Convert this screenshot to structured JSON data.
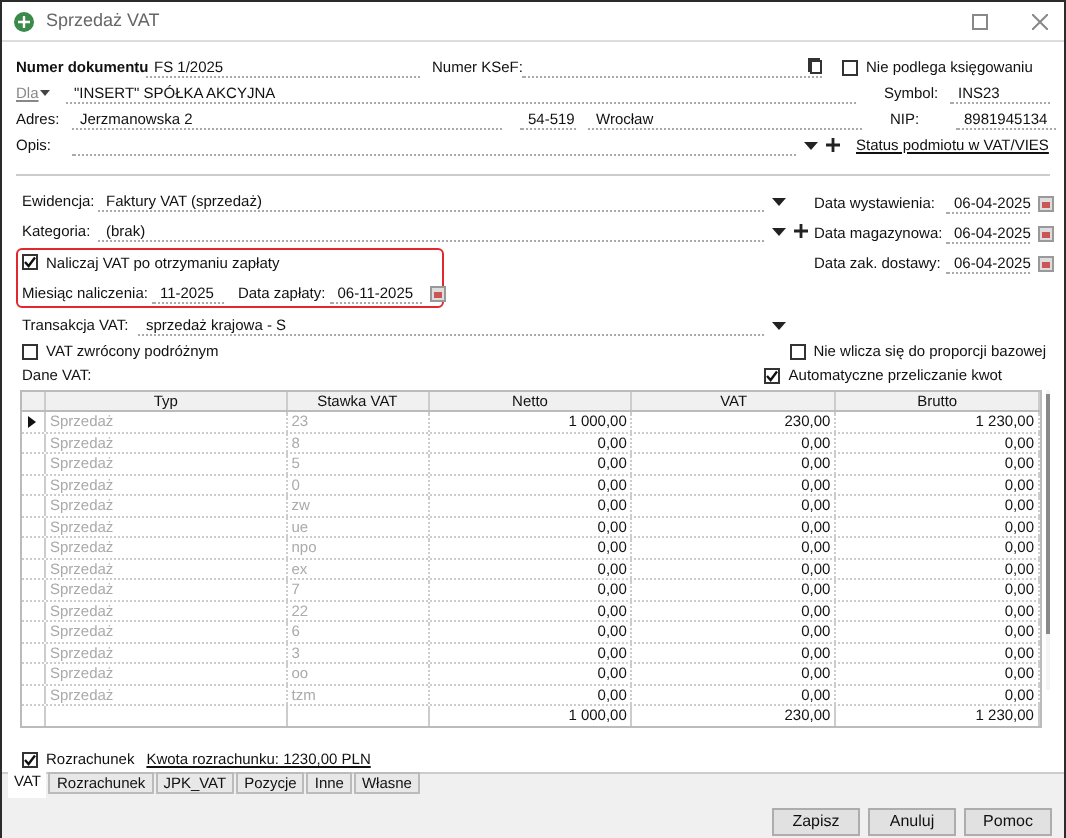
{
  "window": {
    "title": "Sprzedaż VAT"
  },
  "document": {
    "number_label": "Numer dokumentu",
    "number": "FS 1/2025",
    "ksef_label": "Numer KSeF:",
    "not_booked": {
      "label": "Nie podlega księgowaniu",
      "checked": false
    }
  },
  "counterparty": {
    "for_label": "Dla",
    "name": "\"INSERT\" SPÓŁKA AKCYJNA",
    "symbol_label": "Symbol:",
    "symbol": "INS23",
    "address_label": "Adres:",
    "street": "Jerzmanowska 2",
    "postcode": "54-519",
    "city": "Wrocław",
    "nip_label": "NIP:",
    "nip": "8981945134",
    "description_label": "Opis:",
    "vies_link": "Status podmiotu w VAT/VIES"
  },
  "register": {
    "label": "Ewidencja:",
    "value": "Faktury VAT (sprzedaż)"
  },
  "category": {
    "label": "Kategoria:",
    "value": "(brak)"
  },
  "dates": [
    {
      "label": "Data wystawienia:",
      "value": "06-04-2025"
    },
    {
      "label": "Data magazynowa:",
      "value": "06-04-2025"
    },
    {
      "label": "Data zak. dostawy:",
      "value": "06-04-2025"
    }
  ],
  "cash_vat": {
    "label": "Naliczaj VAT po otrzymaniu zapłaty",
    "checked": true,
    "month_label": "Miesiąc naliczenia:",
    "month": "11-2025",
    "payment_date_label": "Data zapłaty:",
    "payment_date": "06-11-2025"
  },
  "transaction": {
    "label": "Transakcja VAT:",
    "value": "sprzedaż krajowa - S"
  },
  "options": [
    {
      "label": "VAT zwrócony podróżnym",
      "checked": false
    },
    {
      "label": "Nie wlicza się do proporcji bazowej",
      "checked": false
    },
    {
      "label": "Automatyczne przeliczanie kwot",
      "checked": true
    }
  ],
  "table": {
    "label": "Dane VAT:",
    "columns": [
      "Typ",
      "Stawka VAT",
      "Netto",
      "VAT",
      "Brutto"
    ],
    "rows": [
      {
        "cells": [
          "Sprzedaż",
          "23",
          "1 000,00",
          "230,00",
          "1 230,00"
        ],
        "selected": true
      },
      {
        "cells": [
          "Sprzedaż",
          "8",
          "0,00",
          "0,00",
          "0,00"
        ],
        "selected": false
      },
      {
        "cells": [
          "Sprzedaż",
          "5",
          "0,00",
          "0,00",
          "0,00"
        ],
        "selected": false
      },
      {
        "cells": [
          "Sprzedaż",
          "0",
          "0,00",
          "0,00",
          "0,00"
        ],
        "selected": false
      },
      {
        "cells": [
          "Sprzedaż",
          "zw",
          "0,00",
          "0,00",
          "0,00"
        ],
        "selected": false
      },
      {
        "cells": [
          "Sprzedaż",
          "ue",
          "0,00",
          "0,00",
          "0,00"
        ],
        "selected": false
      },
      {
        "cells": [
          "Sprzedaż",
          "npo",
          "0,00",
          "0,00",
          "0,00"
        ],
        "selected": false
      },
      {
        "cells": [
          "Sprzedaż",
          "ex",
          "0,00",
          "0,00",
          "0,00"
        ],
        "selected": false
      },
      {
        "cells": [
          "Sprzedaż",
          "7",
          "0,00",
          "0,00",
          "0,00"
        ],
        "selected": false
      },
      {
        "cells": [
          "Sprzedaż",
          "22",
          "0,00",
          "0,00",
          "0,00"
        ],
        "selected": false
      },
      {
        "cells": [
          "Sprzedaż",
          "6",
          "0,00",
          "0,00",
          "0,00"
        ],
        "selected": false
      },
      {
        "cells": [
          "Sprzedaż",
          "3",
          "0,00",
          "0,00",
          "0,00"
        ],
        "selected": false
      },
      {
        "cells": [
          "Sprzedaż",
          "oo",
          "0,00",
          "0,00",
          "0,00"
        ],
        "selected": false
      },
      {
        "cells": [
          "Sprzedaż",
          "tzm",
          "0,00",
          "0,00",
          "0,00"
        ],
        "selected": false
      }
    ],
    "totals": [
      "1 000,00",
      "230,00",
      "1 230,00"
    ]
  },
  "settlement": {
    "label": "Rozrachunek",
    "checked": true,
    "amount_link": "Kwota rozrachunku: 1230,00 PLN"
  },
  "tabs": [
    {
      "label": "VAT",
      "selected": true
    },
    {
      "label": "Rozrachunek",
      "selected": false
    },
    {
      "label": "JPK_VAT",
      "selected": false
    },
    {
      "label": "Pozycje",
      "selected": false
    },
    {
      "label": "Inne",
      "selected": false
    },
    {
      "label": "Własne",
      "selected": false
    }
  ],
  "buttons": [
    "Zapisz",
    "Anuluj",
    "Pomoc"
  ]
}
